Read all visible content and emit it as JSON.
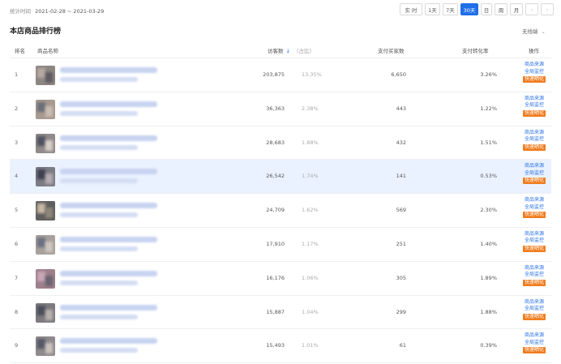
{
  "header": {
    "period_label": "统计时间",
    "period_value": "2021-02-28 ~ 2021-03-29",
    "range_buttons": [
      "实 时",
      "1天",
      "7天",
      "30天",
      "日",
      "周",
      "月"
    ],
    "active_range": "30天",
    "prev_arrow": "‹",
    "next_arrow": "›"
  },
  "panel": {
    "title": "本店商品排行榜",
    "dropdown_label": "无线端"
  },
  "table": {
    "columns": {
      "rank": "排名",
      "product": "商品名称",
      "visitors": "访客数",
      "share": "（占比）",
      "buyers": "支付买家数",
      "conversion": "支付转化率",
      "actions": "操作"
    },
    "action_labels": {
      "source": "商品来源",
      "monitor": "全局监控",
      "quick": "快速晒化"
    },
    "rows": [
      {
        "rank": "1",
        "visitors": "203,875",
        "share": "13.35%",
        "buyers": "6,650",
        "conversion": "3.26%"
      },
      {
        "rank": "2",
        "visitors": "36,363",
        "share": "2.38%",
        "buyers": "443",
        "conversion": "1.22%"
      },
      {
        "rank": "3",
        "visitors": "28,683",
        "share": "1.88%",
        "buyers": "432",
        "conversion": "1.51%"
      },
      {
        "rank": "4",
        "visitors": "26,542",
        "share": "1.74%",
        "buyers": "141",
        "conversion": "0.53%"
      },
      {
        "rank": "5",
        "visitors": "24,709",
        "share": "1.62%",
        "buyers": "569",
        "conversion": "2.30%"
      },
      {
        "rank": "6",
        "visitors": "17,910",
        "share": "1.17%",
        "buyers": "251",
        "conversion": "1.40%"
      },
      {
        "rank": "7",
        "visitors": "16,176",
        "share": "1.06%",
        "buyers": "305",
        "conversion": "1.89%"
      },
      {
        "rank": "8",
        "visitors": "15,887",
        "share": "1.04%",
        "buyers": "299",
        "conversion": "1.88%"
      },
      {
        "rank": "9",
        "visitors": "15,493",
        "share": "1.01%",
        "buyers": "61",
        "conversion": "0.39%"
      }
    ],
    "highlighted_row": "4"
  },
  "colors": {
    "accent": "#1e6fe8",
    "link": "#2b73e8",
    "badge": "#f07c1e",
    "highlight_row": "#eaf2ff"
  },
  "icons": [
    "sort-down-icon",
    "chevron-down-icon",
    "prev-arrow-icon",
    "next-arrow-icon"
  ]
}
